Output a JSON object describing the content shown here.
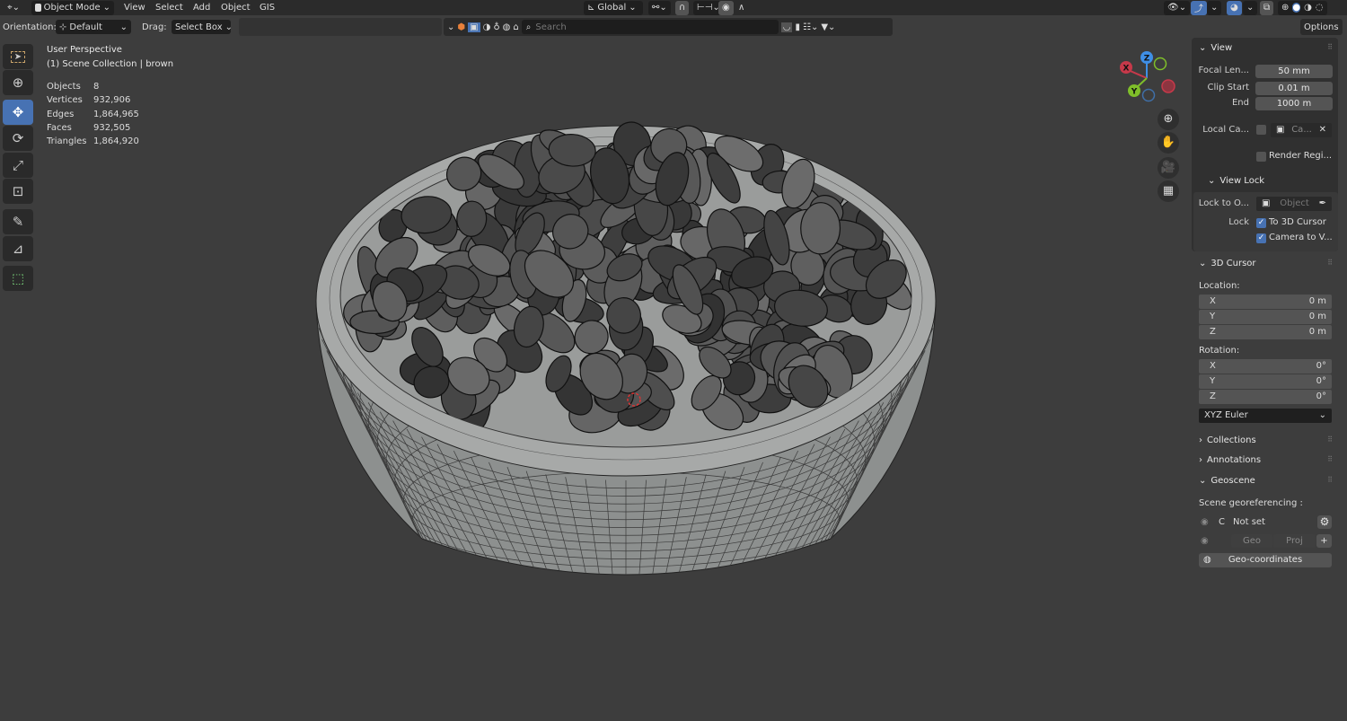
{
  "header": {
    "mode": "Object Mode",
    "menus": [
      "View",
      "Select",
      "Add",
      "Object",
      "GIS"
    ],
    "orientation_transform": "Global",
    "options": "Options"
  },
  "toolbar": {
    "orientation_label": "Orientation:",
    "orientation_value": "Default",
    "drag_label": "Drag:",
    "drag_value": "Select Box",
    "search_placeholder": "Search"
  },
  "viewport": {
    "title": "User Perspective",
    "collection": "(1) Scene Collection | brown",
    "stats": [
      {
        "k": "Objects",
        "v": "8"
      },
      {
        "k": "Vertices",
        "v": "932,906"
      },
      {
        "k": "Edges",
        "v": "1,864,965"
      },
      {
        "k": "Faces",
        "v": "932,505"
      },
      {
        "k": "Triangles",
        "v": "1,864,920"
      }
    ],
    "gizmo": {
      "x": "X",
      "y": "Y",
      "z": "Z",
      "colors": {
        "x": "#c6394a",
        "y": "#7fbf2a",
        "z": "#3f8fe6"
      }
    },
    "tools": [
      "select-box",
      "cursor",
      "move",
      "rotate",
      "scale",
      "transform",
      "annotate",
      "measure",
      "add-cube"
    ],
    "active_tool": "move"
  },
  "sidebar": {
    "view": {
      "title": "View",
      "focal_label": "Focal Len...",
      "focal": "50 mm",
      "clip_start_label": "Clip Start",
      "clip_start": "0.01 m",
      "end_label": "End",
      "end": "1000 m",
      "local_cam_label": "Local Ca...",
      "local_cam_value": "Ca...",
      "render_region": "Render Regi..."
    },
    "view_lock": {
      "title": "View Lock",
      "lock_to_label": "Lock to O...",
      "lock_to_placeholder": "Object",
      "lock_label": "Lock",
      "to_cursor": "To 3D Cursor",
      "camera_to_view": "Camera to V..."
    },
    "cursor": {
      "title": "3D Cursor",
      "location_label": "Location:",
      "loc": [
        {
          "a": "X",
          "v": "0 m"
        },
        {
          "a": "Y",
          "v": "0 m"
        },
        {
          "a": "Z",
          "v": "0 m"
        }
      ],
      "rotation_label": "Rotation:",
      "rot": [
        {
          "a": "X",
          "v": "0°"
        },
        {
          "a": "Y",
          "v": "0°"
        },
        {
          "a": "Z",
          "v": "0°"
        }
      ],
      "rotation_mode": "XYZ Euler"
    },
    "collections": "Collections",
    "annotations": "Annotations",
    "geoscene": {
      "title": "Geoscene",
      "georef_label": "Scene georeferencing :",
      "crs_letter": "C",
      "crs_value": "Not set",
      "geo": "Geo",
      "proj": "Proj",
      "geo_coords": "Geo-coordinates"
    }
  },
  "colors": {
    "accent": "#4772b3",
    "bg": "#3d3d3d",
    "header": "#2b2b2b"
  }
}
